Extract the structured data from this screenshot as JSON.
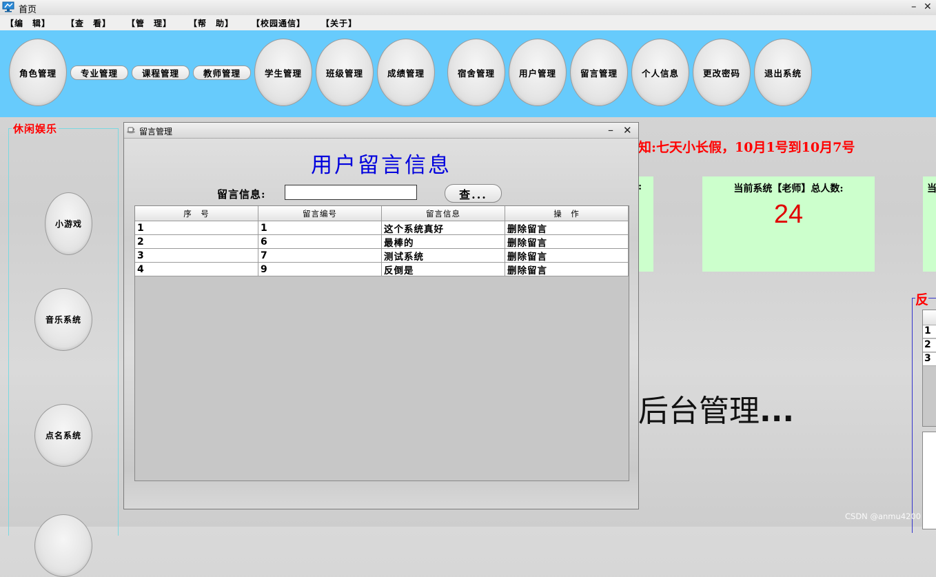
{
  "window": {
    "title": "首页",
    "minimize": "–",
    "close": "✕"
  },
  "menu": [
    "【编　辑】",
    "【查　看】",
    "【管　理】",
    "【帮　助】",
    "【校园通信】",
    "【关于】"
  ],
  "toolbar": {
    "buttons": [
      "角色管理",
      "专业管理",
      "课程管理",
      "教师管理",
      "学生管理",
      "班级管理",
      "成绩管理",
      "宿舍管理",
      "用户管理",
      "留言管理",
      "个人信息",
      "更改密码",
      "退出系统"
    ]
  },
  "leisure": {
    "title": "休闲娱乐",
    "buttons": [
      "小游戏",
      "音乐系统",
      "点名系统"
    ]
  },
  "notice": "知:七天小长假，10月1号到10月7号",
  "stats": {
    "left_label_fragment": ":",
    "teacher_label": "当前系统【老师】总人数:",
    "teacher_count": "24",
    "right_label_fragment": "当"
  },
  "background_text": "后台管理",
  "background_text_suffix": "...",
  "feedback": {
    "title": "反",
    "rows": [
      "1",
      "2",
      "3"
    ]
  },
  "dialog": {
    "title": "留言管理",
    "minimize": "–",
    "close": "✕",
    "heading": "用户留言信息",
    "search_label": "留言信息:",
    "search_value": "",
    "search_button": "查...",
    "table": {
      "columns": [
        "序　号",
        "留言编号",
        "留言信息",
        "操　作"
      ],
      "rows": [
        [
          "1",
          "1",
          "这个系统真好",
          "删除留言"
        ],
        [
          "2",
          "6",
          "最棒的",
          "删除留言"
        ],
        [
          "3",
          "7",
          "测试系统",
          "删除留言"
        ],
        [
          "4",
          "9",
          "反倒是",
          "删除留言"
        ]
      ]
    }
  },
  "watermark": "CSDN @anmu4200"
}
